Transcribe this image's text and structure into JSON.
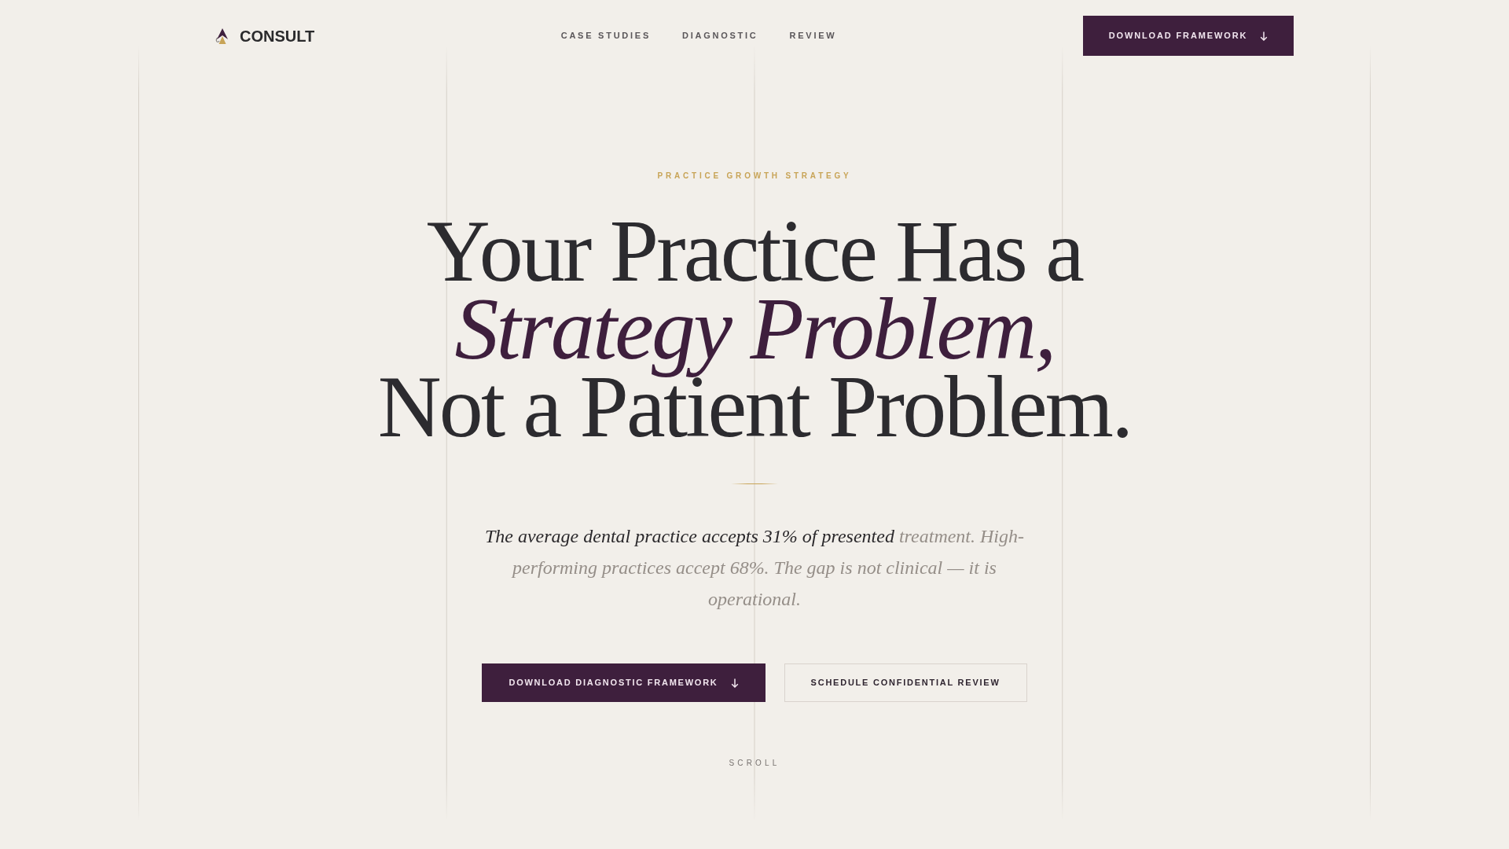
{
  "header": {
    "logo": {
      "text": "CONSULT"
    },
    "nav_links": [
      {
        "label": "CASE STUDIES"
      },
      {
        "label": "DIAGNOSTIC"
      },
      {
        "label": "REVIEW"
      }
    ],
    "cta": {
      "label": "DOWNLOAD FRAMEWORK"
    }
  },
  "hero": {
    "eyebrow": "PRACTICE GROWTH STRATEGY",
    "headline": "Your Practice Has a *Strategy Problem,* Not a Patient Problem.",
    "intro": {
      "revealed_text": "The average dental practice accepts 31% of presented",
      "faded_text": "treatment. High-performing practices accept 68%. The gap is not clinical — it is operational."
    },
    "buttons": [
      {
        "label": "DOWNLOAD DIAGNOSTIC FRAMEWORK",
        "kind": "primary"
      },
      {
        "label": "SCHEDULE CONFIDENTIAL REVIEW",
        "kind": "secondary"
      }
    ],
    "scroll_hint": "SCROLL"
  }
}
